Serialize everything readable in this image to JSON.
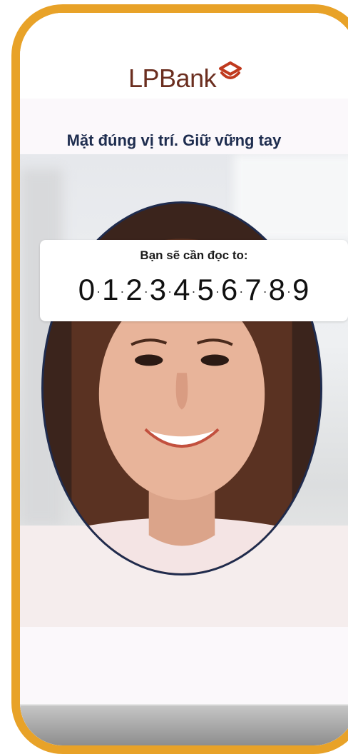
{
  "app": {
    "brand_text": "LPBank",
    "brand_color": "#6b2e1f",
    "frame_color": "#e8a228"
  },
  "instruction": {
    "text": "Mặt đúng vị trí. Giữ vững tay"
  },
  "read_prompt": {
    "label": "Bạn sẽ cần đọc to:",
    "digits": [
      "0",
      "1",
      "2",
      "3",
      "4",
      "5",
      "6",
      "7",
      "8",
      "9"
    ]
  },
  "icons": {
    "logo_mark": "lpbank-logo-icon"
  }
}
